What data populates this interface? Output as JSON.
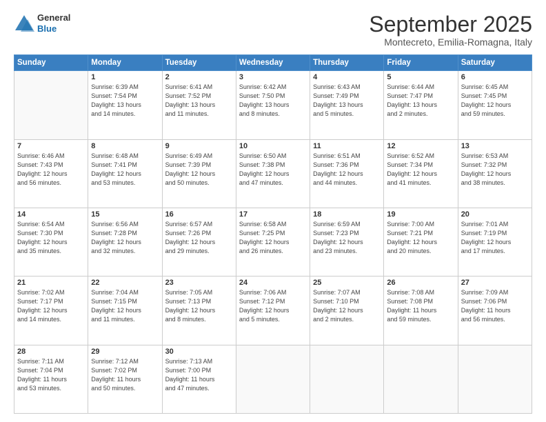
{
  "header": {
    "logo": {
      "general": "General",
      "blue": "Blue"
    },
    "title": "September 2025",
    "location": "Montecreto, Emilia-Romagna, Italy"
  },
  "calendar": {
    "headers": [
      "Sunday",
      "Monday",
      "Tuesday",
      "Wednesday",
      "Thursday",
      "Friday",
      "Saturday"
    ],
    "weeks": [
      [
        {
          "day": "",
          "info": ""
        },
        {
          "day": "1",
          "info": "Sunrise: 6:39 AM\nSunset: 7:54 PM\nDaylight: 13 hours\nand 14 minutes."
        },
        {
          "day": "2",
          "info": "Sunrise: 6:41 AM\nSunset: 7:52 PM\nDaylight: 13 hours\nand 11 minutes."
        },
        {
          "day": "3",
          "info": "Sunrise: 6:42 AM\nSunset: 7:50 PM\nDaylight: 13 hours\nand 8 minutes."
        },
        {
          "day": "4",
          "info": "Sunrise: 6:43 AM\nSunset: 7:49 PM\nDaylight: 13 hours\nand 5 minutes."
        },
        {
          "day": "5",
          "info": "Sunrise: 6:44 AM\nSunset: 7:47 PM\nDaylight: 13 hours\nand 2 minutes."
        },
        {
          "day": "6",
          "info": "Sunrise: 6:45 AM\nSunset: 7:45 PM\nDaylight: 12 hours\nand 59 minutes."
        }
      ],
      [
        {
          "day": "7",
          "info": "Sunrise: 6:46 AM\nSunset: 7:43 PM\nDaylight: 12 hours\nand 56 minutes."
        },
        {
          "day": "8",
          "info": "Sunrise: 6:48 AM\nSunset: 7:41 PM\nDaylight: 12 hours\nand 53 minutes."
        },
        {
          "day": "9",
          "info": "Sunrise: 6:49 AM\nSunset: 7:39 PM\nDaylight: 12 hours\nand 50 minutes."
        },
        {
          "day": "10",
          "info": "Sunrise: 6:50 AM\nSunset: 7:38 PM\nDaylight: 12 hours\nand 47 minutes."
        },
        {
          "day": "11",
          "info": "Sunrise: 6:51 AM\nSunset: 7:36 PM\nDaylight: 12 hours\nand 44 minutes."
        },
        {
          "day": "12",
          "info": "Sunrise: 6:52 AM\nSunset: 7:34 PM\nDaylight: 12 hours\nand 41 minutes."
        },
        {
          "day": "13",
          "info": "Sunrise: 6:53 AM\nSunset: 7:32 PM\nDaylight: 12 hours\nand 38 minutes."
        }
      ],
      [
        {
          "day": "14",
          "info": "Sunrise: 6:54 AM\nSunset: 7:30 PM\nDaylight: 12 hours\nand 35 minutes."
        },
        {
          "day": "15",
          "info": "Sunrise: 6:56 AM\nSunset: 7:28 PM\nDaylight: 12 hours\nand 32 minutes."
        },
        {
          "day": "16",
          "info": "Sunrise: 6:57 AM\nSunset: 7:26 PM\nDaylight: 12 hours\nand 29 minutes."
        },
        {
          "day": "17",
          "info": "Sunrise: 6:58 AM\nSunset: 7:25 PM\nDaylight: 12 hours\nand 26 minutes."
        },
        {
          "day": "18",
          "info": "Sunrise: 6:59 AM\nSunset: 7:23 PM\nDaylight: 12 hours\nand 23 minutes."
        },
        {
          "day": "19",
          "info": "Sunrise: 7:00 AM\nSunset: 7:21 PM\nDaylight: 12 hours\nand 20 minutes."
        },
        {
          "day": "20",
          "info": "Sunrise: 7:01 AM\nSunset: 7:19 PM\nDaylight: 12 hours\nand 17 minutes."
        }
      ],
      [
        {
          "day": "21",
          "info": "Sunrise: 7:02 AM\nSunset: 7:17 PM\nDaylight: 12 hours\nand 14 minutes."
        },
        {
          "day": "22",
          "info": "Sunrise: 7:04 AM\nSunset: 7:15 PM\nDaylight: 12 hours\nand 11 minutes."
        },
        {
          "day": "23",
          "info": "Sunrise: 7:05 AM\nSunset: 7:13 PM\nDaylight: 12 hours\nand 8 minutes."
        },
        {
          "day": "24",
          "info": "Sunrise: 7:06 AM\nSunset: 7:12 PM\nDaylight: 12 hours\nand 5 minutes."
        },
        {
          "day": "25",
          "info": "Sunrise: 7:07 AM\nSunset: 7:10 PM\nDaylight: 12 hours\nand 2 minutes."
        },
        {
          "day": "26",
          "info": "Sunrise: 7:08 AM\nSunset: 7:08 PM\nDaylight: 11 hours\nand 59 minutes."
        },
        {
          "day": "27",
          "info": "Sunrise: 7:09 AM\nSunset: 7:06 PM\nDaylight: 11 hours\nand 56 minutes."
        }
      ],
      [
        {
          "day": "28",
          "info": "Sunrise: 7:11 AM\nSunset: 7:04 PM\nDaylight: 11 hours\nand 53 minutes."
        },
        {
          "day": "29",
          "info": "Sunrise: 7:12 AM\nSunset: 7:02 PM\nDaylight: 11 hours\nand 50 minutes."
        },
        {
          "day": "30",
          "info": "Sunrise: 7:13 AM\nSunset: 7:00 PM\nDaylight: 11 hours\nand 47 minutes."
        },
        {
          "day": "",
          "info": ""
        },
        {
          "day": "",
          "info": ""
        },
        {
          "day": "",
          "info": ""
        },
        {
          "day": "",
          "info": ""
        }
      ]
    ]
  }
}
